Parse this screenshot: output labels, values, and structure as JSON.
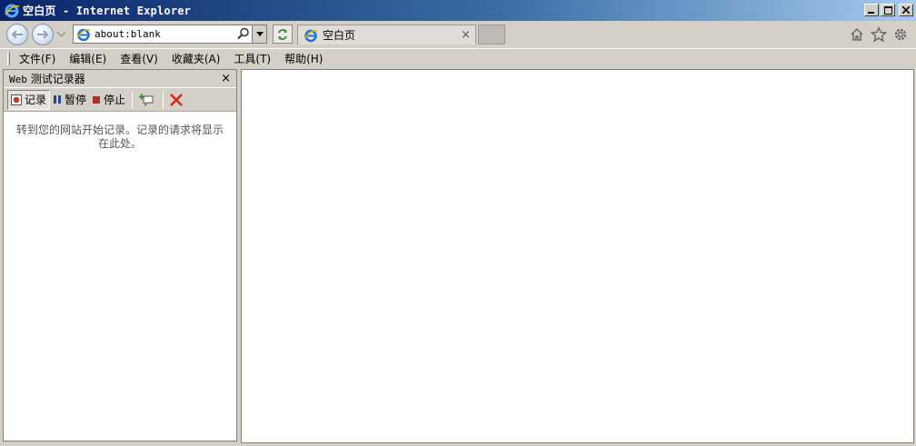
{
  "window": {
    "title": "空白页 - Internet Explorer"
  },
  "nav": {
    "address": "about:blank",
    "tab_title": "空白页",
    "tab_close": "×"
  },
  "menu": {
    "items": [
      "文件(F)",
      "编辑(E)",
      "查看(V)",
      "收藏夹(A)",
      "工具(T)",
      "帮助(H)"
    ]
  },
  "recorder": {
    "title_prefix": "Web",
    "title_rest": " 测试记录器",
    "close": "×",
    "record_label": "记录",
    "pause_label": "暂停",
    "stop_label": "停止",
    "message": "转到您的网站开始记录。记录的请求将显示在此处。"
  },
  "colors": {
    "titlebar_start": "#0a246a",
    "titlebar_end": "#a6caf0",
    "record": "#c0392b",
    "pause": "#1f4e8c",
    "delete": "#d6281e",
    "add": "#2c8c2c"
  },
  "icons": {
    "app": "ie-icon",
    "back": "back-arrow-icon",
    "forward": "forward-arrow-icon",
    "refresh": "refresh-icon",
    "home": "home-icon",
    "favorites": "star-icon",
    "tools": "gear-icon"
  }
}
